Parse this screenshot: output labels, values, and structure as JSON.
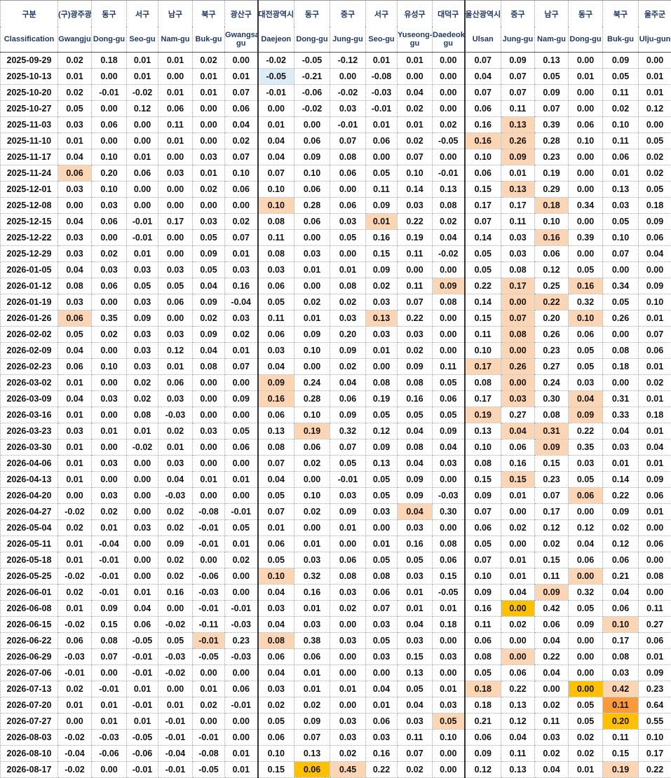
{
  "header_korean": [
    "구분",
    "(구)광주광",
    "동구",
    "서구",
    "남구",
    "북구",
    "광산구",
    "대전광역시",
    "동구",
    "중구",
    "서구",
    "유성구",
    "대덕구",
    "울산광역시",
    "중구",
    "남구",
    "동구",
    "북구",
    "울주군"
  ],
  "header_english": [
    "Classification",
    "Gwangju",
    "Dong-gu",
    "Seo-gu",
    "Nam-gu",
    "Buk-gu",
    "Gwangsan-gu",
    "Daejeon",
    "Dong-gu",
    "Jung-gu",
    "Seo-gu",
    "Yuseong-gu",
    "Daedeok-gu",
    "Ulsan",
    "Jung-gu",
    "Nam-gu",
    "Dong-gu",
    "Buk-gu",
    "Ulju-gun"
  ],
  "highlight_colors": {
    "light": "#fcd5b4",
    "strong": "#ffc000",
    "max": "#fc9a3a",
    "negative": "#ddebf7"
  },
  "rows": [
    {
      "date": "2025-09-29",
      "v": [
        "0.02",
        "0.18",
        "0.01",
        "0.01",
        "0.02",
        "0.00",
        "-0.02",
        "-0.05",
        "-0.12",
        "0.01",
        "0.01",
        "0.00",
        "0.07",
        "0.09",
        "0.13",
        "0.00",
        "0.09",
        "0.00"
      ]
    },
    {
      "date": "2025-10-13",
      "v": [
        "0.01",
        "0.00",
        "0.01",
        "0.00",
        "0.01",
        "0.01",
        "-0.05",
        "-0.21",
        "0.00",
        "-0.08",
        "0.00",
        "0.00",
        "0.04",
        "0.07",
        "0.05",
        "0.01",
        "0.05",
        "0.01"
      ]
    },
    {
      "date": "2025-10-20",
      "v": [
        "0.02",
        "-0.01",
        "-0.02",
        "0.01",
        "0.01",
        "0.07",
        "-0.01",
        "-0.06",
        "-0.02",
        "-0.03",
        "0.04",
        "0.00",
        "0.07",
        "0.07",
        "0.09",
        "0.00",
        "0.11",
        "0.01"
      ]
    },
    {
      "date": "2025-10-27",
      "v": [
        "0.05",
        "0.00",
        "0.12",
        "0.06",
        "0.00",
        "0.06",
        "0.00",
        "-0.02",
        "0.03",
        "-0.01",
        "0.02",
        "0.00",
        "0.06",
        "0.11",
        "0.07",
        "0.00",
        "0.02",
        "0.12"
      ]
    },
    {
      "date": "2025-11-03",
      "v": [
        "0.03",
        "0.06",
        "0.00",
        "0.11",
        "0.00",
        "0.04",
        "0.01",
        "0.00",
        "-0.01",
        "0.01",
        "0.01",
        "0.02",
        "0.16",
        "0.13",
        "0.39",
        "0.06",
        "0.10",
        "0.00"
      ]
    },
    {
      "date": "2025-11-10",
      "v": [
        "0.01",
        "0.00",
        "0.00",
        "0.01",
        "0.00",
        "0.02",
        "0.04",
        "0.06",
        "0.07",
        "0.06",
        "0.02",
        "-0.05",
        "0.16",
        "0.26",
        "0.28",
        "0.10",
        "0.11",
        "0.05"
      ]
    },
    {
      "date": "2025-11-17",
      "v": [
        "0.04",
        "0.10",
        "0.01",
        "0.00",
        "0.03",
        "0.07",
        "0.04",
        "0.09",
        "0.08",
        "0.00",
        "0.07",
        "0.00",
        "0.10",
        "0.09",
        "0.23",
        "0.00",
        "0.06",
        "0.02"
      ]
    },
    {
      "date": "2025-11-24",
      "v": [
        "0.06",
        "0.20",
        "0.06",
        "0.03",
        "0.01",
        "0.10",
        "0.07",
        "0.10",
        "0.06",
        "0.05",
        "0.10",
        "-0.01",
        "0.06",
        "0.01",
        "0.19",
        "0.00",
        "0.01",
        "0.02"
      ]
    },
    {
      "date": "2025-12-01",
      "v": [
        "0.03",
        "0.10",
        "0.00",
        "0.00",
        "0.02",
        "0.06",
        "0.10",
        "0.06",
        "0.00",
        "0.11",
        "0.14",
        "0.13",
        "0.15",
        "0.13",
        "0.29",
        "0.00",
        "0.13",
        "0.05"
      ]
    },
    {
      "date": "2025-12-08",
      "v": [
        "0.00",
        "0.03",
        "0.00",
        "0.00",
        "0.00",
        "0.00",
        "0.10",
        "0.28",
        "0.06",
        "0.09",
        "0.03",
        "0.08",
        "0.17",
        "0.17",
        "0.18",
        "0.34",
        "0.03",
        "0.18"
      ]
    },
    {
      "date": "2025-12-15",
      "v": [
        "0.04",
        "0.06",
        "-0.01",
        "0.17",
        "0.03",
        "0.02",
        "0.08",
        "0.06",
        "0.03",
        "0.01",
        "0.22",
        "0.02",
        "0.07",
        "0.11",
        "0.10",
        "0.00",
        "0.05",
        "0.09"
      ]
    },
    {
      "date": "2025-12-22",
      "v": [
        "0.03",
        "0.00",
        "-0.01",
        "0.00",
        "0.05",
        "0.07",
        "0.11",
        "0.00",
        "0.05",
        "0.16",
        "0.19",
        "0.04",
        "0.14",
        "0.03",
        "0.16",
        "0.39",
        "0.10",
        "0.06"
      ]
    },
    {
      "date": "2025-12-29",
      "v": [
        "0.03",
        "0.02",
        "0.01",
        "0.00",
        "0.09",
        "0.01",
        "0.08",
        "0.03",
        "0.00",
        "0.15",
        "0.11",
        "-0.02",
        "0.05",
        "0.03",
        "0.06",
        "0.00",
        "0.07",
        "0.04"
      ]
    },
    {
      "date": "2026-01-05",
      "v": [
        "0.04",
        "0.03",
        "0.03",
        "0.03",
        "0.05",
        "0.03",
        "0.03",
        "0.01",
        "0.01",
        "0.09",
        "0.00",
        "0.00",
        "0.05",
        "0.08",
        "0.12",
        "0.05",
        "0.00",
        "0.00"
      ]
    },
    {
      "date": "2026-01-12",
      "v": [
        "0.08",
        "0.06",
        "0.05",
        "0.05",
        "0.04",
        "0.16",
        "0.06",
        "0.00",
        "0.08",
        "0.02",
        "0.11",
        "0.09",
        "0.22",
        "0.17",
        "0.25",
        "0.16",
        "0.34",
        "0.09"
      ]
    },
    {
      "date": "2026-01-19",
      "v": [
        "0.03",
        "0.00",
        "0.03",
        "0.06",
        "0.09",
        "-0.04",
        "0.05",
        "0.02",
        "0.02",
        "0.03",
        "0.07",
        "0.08",
        "0.14",
        "0.00",
        "0.22",
        "0.32",
        "0.05",
        "0.10"
      ]
    },
    {
      "date": "2026-01-26",
      "v": [
        "0.06",
        "0.35",
        "0.09",
        "0.00",
        "0.02",
        "0.03",
        "0.11",
        "0.01",
        "0.03",
        "0.13",
        "0.22",
        "0.00",
        "0.15",
        "0.07",
        "0.20",
        "0.10",
        "0.26",
        "0.01"
      ]
    },
    {
      "date": "2026-02-02",
      "v": [
        "0.05",
        "0.02",
        "0.03",
        "0.03",
        "0.09",
        "0.02",
        "0.06",
        "0.09",
        "0.20",
        "0.03",
        "0.03",
        "0.00",
        "0.11",
        "0.08",
        "0.26",
        "0.06",
        "0.00",
        "0.07"
      ]
    },
    {
      "date": "2026-02-09",
      "v": [
        "0.04",
        "0.00",
        "0.03",
        "0.12",
        "0.04",
        "0.01",
        "0.03",
        "0.10",
        "0.09",
        "0.01",
        "0.02",
        "0.00",
        "0.10",
        "0.00",
        "0.23",
        "0.05",
        "0.08",
        "0.06"
      ]
    },
    {
      "date": "2026-02-23",
      "v": [
        "0.06",
        "0.10",
        "0.03",
        "0.01",
        "0.08",
        "0.07",
        "0.04",
        "0.00",
        "0.02",
        "0.00",
        "0.09",
        "0.11",
        "0.17",
        "0.26",
        "0.27",
        "0.05",
        "0.18",
        "0.01"
      ]
    },
    {
      "date": "2026-03-02",
      "v": [
        "0.01",
        "0.00",
        "0.02",
        "0.06",
        "0.00",
        "0.00",
        "0.09",
        "0.24",
        "0.04",
        "0.08",
        "0.08",
        "0.05",
        "0.08",
        "0.00",
        "0.24",
        "0.03",
        "0.00",
        "0.02"
      ]
    },
    {
      "date": "2026-03-09",
      "v": [
        "0.04",
        "0.03",
        "0.02",
        "0.03",
        "0.00",
        "0.09",
        "0.16",
        "0.28",
        "0.06",
        "0.19",
        "0.16",
        "0.06",
        "0.17",
        "0.03",
        "0.30",
        "0.04",
        "0.31",
        "0.01"
      ]
    },
    {
      "date": "2026-03-16",
      "v": [
        "0.01",
        "0.00",
        "0.08",
        "-0.03",
        "0.00",
        "0.00",
        "0.06",
        "0.10",
        "0.09",
        "0.05",
        "0.05",
        "0.05",
        "0.19",
        "0.27",
        "0.08",
        "0.09",
        "0.33",
        "0.18"
      ]
    },
    {
      "date": "2026-03-23",
      "v": [
        "0.03",
        "0.01",
        "0.01",
        "0.02",
        "0.03",
        "0.05",
        "0.13",
        "0.19",
        "0.32",
        "0.12",
        "0.04",
        "0.09",
        "0.13",
        "0.04",
        "0.31",
        "0.22",
        "0.04",
        "0.01"
      ]
    },
    {
      "date": "2026-03-30",
      "v": [
        "0.01",
        "0.00",
        "-0.02",
        "0.01",
        "0.00",
        "0.06",
        "0.08",
        "0.06",
        "0.07",
        "0.09",
        "0.08",
        "0.04",
        "0.10",
        "0.06",
        "0.09",
        "0.35",
        "0.03",
        "0.04"
      ]
    },
    {
      "date": "2026-04-06",
      "v": [
        "0.01",
        "0.03",
        "0.00",
        "0.03",
        "0.00",
        "0.00",
        "0.07",
        "0.02",
        "0.05",
        "0.13",
        "0.04",
        "0.03",
        "0.08",
        "0.16",
        "0.15",
        "0.03",
        "0.01",
        "0.01"
      ]
    },
    {
      "date": "2026-04-13",
      "v": [
        "0.01",
        "0.00",
        "0.00",
        "0.04",
        "0.01",
        "0.01",
        "0.04",
        "0.00",
        "-0.01",
        "0.05",
        "0.09",
        "0.00",
        "0.15",
        "0.15",
        "0.23",
        "0.05",
        "0.14",
        "0.09"
      ]
    },
    {
      "date": "2026-04-20",
      "v": [
        "0.00",
        "0.03",
        "0.00",
        "-0.03",
        "0.00",
        "0.00",
        "0.05",
        "0.10",
        "0.03",
        "0.05",
        "0.09",
        "-0.03",
        "0.09",
        "0.01",
        "0.07",
        "0.06",
        "0.22",
        "0.06"
      ]
    },
    {
      "date": "2026-04-27",
      "v": [
        "-0.02",
        "0.02",
        "0.00",
        "0.02",
        "-0.08",
        "-0.01",
        "0.07",
        "0.02",
        "0.09",
        "0.03",
        "0.04",
        "0.30",
        "0.07",
        "0.00",
        "0.17",
        "0.00",
        "0.09",
        "0.01"
      ]
    },
    {
      "date": "2026-05-04",
      "v": [
        "0.02",
        "0.01",
        "0.03",
        "0.02",
        "-0.01",
        "0.05",
        "0.01",
        "0.00",
        "0.01",
        "0.00",
        "0.03",
        "0.00",
        "0.06",
        "0.02",
        "0.12",
        "0.12",
        "0.02",
        "0.00"
      ]
    },
    {
      "date": "2026-05-11",
      "v": [
        "0.01",
        "-0.04",
        "0.00",
        "0.09",
        "-0.01",
        "0.01",
        "0.06",
        "0.01",
        "0.00",
        "0.01",
        "0.16",
        "0.08",
        "0.05",
        "0.00",
        "0.02",
        "0.04",
        "0.12",
        "0.06"
      ]
    },
    {
      "date": "2026-05-18",
      "v": [
        "0.01",
        "-0.01",
        "0.00",
        "0.02",
        "0.00",
        "0.02",
        "0.05",
        "0.03",
        "0.06",
        "0.05",
        "0.05",
        "0.06",
        "0.07",
        "0.01",
        "0.15",
        "0.06",
        "0.06",
        "0.00"
      ]
    },
    {
      "date": "2026-05-25",
      "v": [
        "-0.02",
        "-0.01",
        "0.00",
        "0.02",
        "-0.06",
        "0.00",
        "0.10",
        "0.32",
        "0.08",
        "0.08",
        "0.03",
        "0.15",
        "0.10",
        "0.01",
        "0.11",
        "0.00",
        "0.21",
        "0.08"
      ]
    },
    {
      "date": "2026-06-01",
      "v": [
        "0.02",
        "-0.01",
        "0.01",
        "0.16",
        "-0.03",
        "0.00",
        "0.04",
        "0.16",
        "0.03",
        "0.06",
        "0.01",
        "-0.05",
        "0.09",
        "0.04",
        "0.09",
        "0.32",
        "0.04",
        "0.00"
      ]
    },
    {
      "date": "2026-06-08",
      "v": [
        "0.01",
        "0.09",
        "0.04",
        "0.00",
        "-0.01",
        "-0.01",
        "0.03",
        "0.01",
        "0.02",
        "0.07",
        "0.01",
        "0.01",
        "0.16",
        "0.00",
        "0.42",
        "0.05",
        "0.06",
        "0.11"
      ]
    },
    {
      "date": "2026-06-15",
      "v": [
        "-0.02",
        "0.15",
        "0.06",
        "-0.02",
        "-0.11",
        "-0.03",
        "0.04",
        "0.03",
        "0.00",
        "0.03",
        "0.04",
        "0.18",
        "0.11",
        "0.02",
        "0.06",
        "0.09",
        "0.10",
        "0.27"
      ]
    },
    {
      "date": "2026-06-22",
      "v": [
        "0.06",
        "0.08",
        "-0.05",
        "0.05",
        "-0.01",
        "0.23",
        "0.08",
        "0.38",
        "0.03",
        "0.05",
        "0.03",
        "0.00",
        "0.06",
        "0.00",
        "0.04",
        "0.00",
        "0.17",
        "0.06"
      ]
    },
    {
      "date": "2026-06-29",
      "v": [
        "-0.03",
        "0.07",
        "-0.01",
        "-0.03",
        "-0.05",
        "-0.03",
        "0.06",
        "0.06",
        "0.00",
        "0.03",
        "0.15",
        "0.03",
        "0.08",
        "0.00",
        "0.22",
        "0.00",
        "0.08",
        "0.01"
      ]
    },
    {
      "date": "2026-07-06",
      "v": [
        "-0.01",
        "0.00",
        "-0.01",
        "-0.02",
        "0.00",
        "0.00",
        "0.04",
        "0.01",
        "0.00",
        "0.00",
        "0.13",
        "0.00",
        "0.05",
        "0.06",
        "0.04",
        "0.00",
        "0.03",
        "0.09"
      ]
    },
    {
      "date": "2026-07-13",
      "v": [
        "0.02",
        "-0.01",
        "0.01",
        "0.00",
        "0.01",
        "0.06",
        "0.03",
        "0.01",
        "0.01",
        "0.04",
        "0.05",
        "0.01",
        "0.18",
        "0.22",
        "0.00",
        "0.00",
        "0.42",
        "0.23"
      ]
    },
    {
      "date": "2026-07-20",
      "v": [
        "0.01",
        "0.01",
        "-0.01",
        "0.01",
        "0.02",
        "-0.01",
        "0.02",
        "0.02",
        "0.00",
        "0.01",
        "0.04",
        "0.03",
        "0.18",
        "0.13",
        "0.02",
        "0.05",
        "0.11",
        "0.64"
      ]
    },
    {
      "date": "2026-07-27",
      "v": [
        "0.00",
        "0.01",
        "0.01",
        "-0.01",
        "0.00",
        "0.00",
        "0.05",
        "0.09",
        "0.03",
        "0.06",
        "0.03",
        "0.05",
        "0.21",
        "0.12",
        "0.11",
        "0.05",
        "0.20",
        "0.55"
      ]
    },
    {
      "date": "2026-08-03",
      "v": [
        "-0.02",
        "-0.03",
        "-0.05",
        "-0.01",
        "-0.01",
        "0.00",
        "0.06",
        "0.07",
        "0.03",
        "0.03",
        "0.11",
        "0.10",
        "0.06",
        "0.04",
        "0.03",
        "0.02",
        "0.11",
        "0.10"
      ]
    },
    {
      "date": "2026-08-10",
      "v": [
        "-0.04",
        "-0.06",
        "-0.06",
        "-0.04",
        "-0.08",
        "0.01",
        "0.10",
        "0.13",
        "0.02",
        "0.16",
        "0.07",
        "0.00",
        "0.09",
        "0.11",
        "0.02",
        "0.02",
        "0.15",
        "0.17"
      ]
    },
    {
      "date": "2026-08-17",
      "v": [
        "-0.02",
        "0.00",
        "-0.01",
        "-0.01",
        "-0.05",
        "0.01",
        "0.15",
        "0.06",
        "0.45",
        "0.22",
        "0.02",
        "0.00",
        "0.12",
        "0.13",
        "0.04",
        "0.01",
        "0.19",
        "0.22"
      ]
    }
  ],
  "highlights": {
    "2025-10-13": {
      "7": "negative"
    },
    "2025-11-03": {
      "14": "light"
    },
    "2025-11-10": {
      "13": "light",
      "14": "light"
    },
    "2025-11-17": {
      "14": "light"
    },
    "2025-11-24": {
      "1": "light"
    },
    "2025-12-01": {
      "14": "light"
    },
    "2025-12-08": {
      "7": "light",
      "15": "light"
    },
    "2025-12-15": {
      "10": "light"
    },
    "2025-12-22": {
      "15": "light"
    },
    "2026-01-12": {
      "12": "light",
      "14": "light",
      "16": "light"
    },
    "2026-01-19": {
      "14": "light",
      "15": "light"
    },
    "2026-01-26": {
      "1": "light",
      "10": "light",
      "14": "light",
      "16": "light"
    },
    "2026-02-02": {
      "14": "light"
    },
    "2026-02-09": {
      "14": "light"
    },
    "2026-02-23": {
      "13": "light",
      "14": "light"
    },
    "2026-03-02": {
      "7": "light",
      "14": "light"
    },
    "2026-03-09": {
      "7": "light",
      "14": "light",
      "16": "light"
    },
    "2026-03-16": {
      "13": "light",
      "16": "light"
    },
    "2026-03-23": {
      "8": "light",
      "14": "light",
      "15": "light"
    },
    "2026-03-30": {
      "15": "light"
    },
    "2026-04-13": {
      "14": "light"
    },
    "2026-04-20": {
      "16": "light"
    },
    "2026-04-27": {
      "11": "light"
    },
    "2026-05-25": {
      "7": "light",
      "16": "light"
    },
    "2026-06-01": {
      "15": "light"
    },
    "2026-06-08": {
      "14": "strong"
    },
    "2026-06-15": {
      "17": "light"
    },
    "2026-06-22": {
      "5": "light",
      "7": "light"
    },
    "2026-06-29": {
      "14": "light"
    },
    "2026-07-13": {
      "13": "light",
      "16": "strong",
      "17": "light"
    },
    "2026-07-20": {
      "17": "max"
    },
    "2026-07-27": {
      "12": "light",
      "17": "strong"
    },
    "2026-08-17": {
      "8": "strong",
      "9": "light",
      "17": "light"
    }
  }
}
